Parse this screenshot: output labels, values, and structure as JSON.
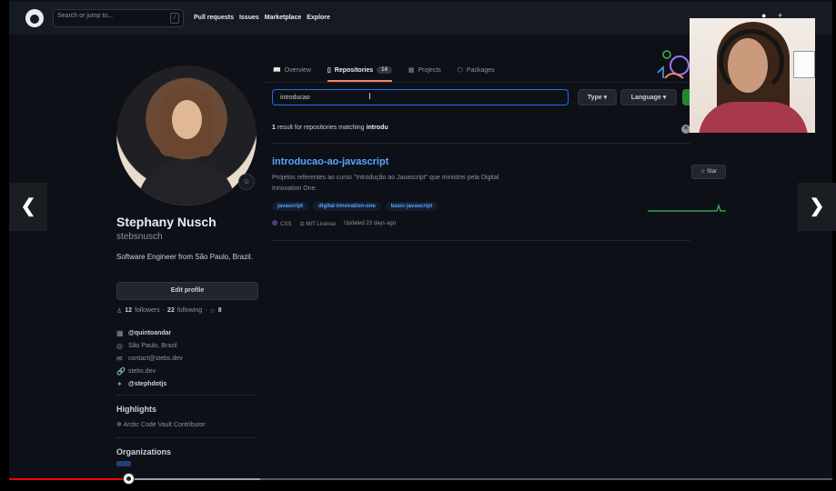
{
  "header": {
    "search_placeholder": "Search or jump to...",
    "slash_key": "/",
    "nav": [
      "Pull requests",
      "Issues",
      "Marketplace",
      "Explore"
    ]
  },
  "tabs": [
    {
      "label": "Overview",
      "icon": "book-icon"
    },
    {
      "label": "Repositories",
      "icon": "repo-icon",
      "count": "14",
      "active": true
    },
    {
      "label": "Projects",
      "icon": "project-icon"
    },
    {
      "label": "Packages",
      "icon": "package-icon"
    }
  ],
  "profile": {
    "name": "Stephany Nusch",
    "username": "stebsnusch",
    "bio": "Software Engineer from São Paulo, Brazil.",
    "edit_label": "Edit profile",
    "followers_count": "12",
    "followers_label": "followers",
    "following_count": "22",
    "following_label": "following",
    "stars_count": "8",
    "company": "@quintoandar",
    "location": "São Paulo, Brazil",
    "email": "contact@stebs.dev",
    "website": "stebs.dev",
    "twitter": "@stephdotjs",
    "highlights_title": "Highlights",
    "highlight_item": "Arctic Code Vault Contributor",
    "organizations_title": "Organizations"
  },
  "repo_filter": {
    "search_value": "introducao",
    "type_label": "Type ▾",
    "language_label": "Language ▾",
    "result_count": "1",
    "result_text": "result for repositories matching",
    "result_query": "introdu"
  },
  "repos": [
    {
      "name": "introducao-ao-javascript",
      "description": "Projetos referentes ao curso \"Introdução ao Javascript\" que ministrei pela Digital Innovation One.",
      "topics": [
        "javascript",
        "digital-innovation-one",
        "basic-javascript"
      ],
      "language": "CSS",
      "language_color": "#563d7c",
      "license": "MIT License",
      "updated": "Updated 23 days ago",
      "star_label": "Star"
    }
  ],
  "video": {
    "progress_fraction": 0.145,
    "buffered_fraction": 0.305
  },
  "colors": {
    "background": "#0d1117",
    "link": "#58a6ff",
    "accent_tab": "#f78166",
    "focus_border": "#1f6feb",
    "progress_red": "#ff0000"
  }
}
